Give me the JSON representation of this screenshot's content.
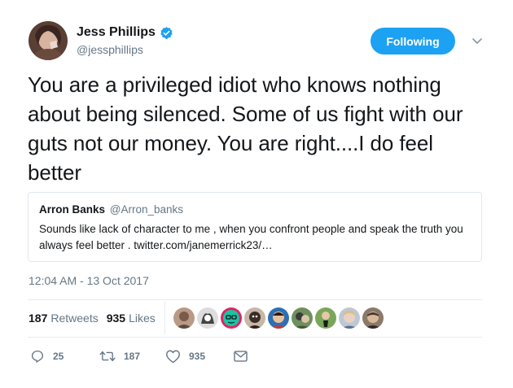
{
  "author": {
    "name": "Jess Phillips",
    "handle": "@jessphillips",
    "verified": true,
    "avatar": "profile-photo"
  },
  "follow_button": {
    "label": "Following",
    "color": "#1da1f2"
  },
  "menu_icon": "chevron-down-icon",
  "tweet": {
    "text": "You are a privileged idiot who knows nothing about being silenced. Some of us fight with our guts not our money. You are right....I do feel better"
  },
  "quoted_tweet": {
    "name": "Arron Banks",
    "handle": "@Arron_banks",
    "text": "Sounds like lack of character to me , when you confront people and speak the truth you always feel better . twitter.com/janemerrick23/…"
  },
  "timestamp": "12:04 AM - 13 Oct 2017",
  "stats": {
    "retweets_count": "187",
    "retweets_label": "Retweets",
    "likes_count": "935",
    "likes_label": "Likes"
  },
  "likers_avatars": [
    "avatar-1",
    "avatar-2",
    "avatar-3",
    "avatar-4",
    "avatar-5",
    "avatar-6",
    "avatar-7",
    "avatar-8",
    "avatar-9"
  ],
  "actions": {
    "reply_icon": "reply-icon",
    "reply_count": "25",
    "retweet_icon": "retweet-icon",
    "retweet_count": "187",
    "like_icon": "heart-icon",
    "like_count": "935",
    "message_icon": "envelope-icon"
  },
  "colors": {
    "accent": "#1da1f2",
    "text": "#14171a",
    "secondary": "#657786",
    "border": "#e1e8ed"
  }
}
